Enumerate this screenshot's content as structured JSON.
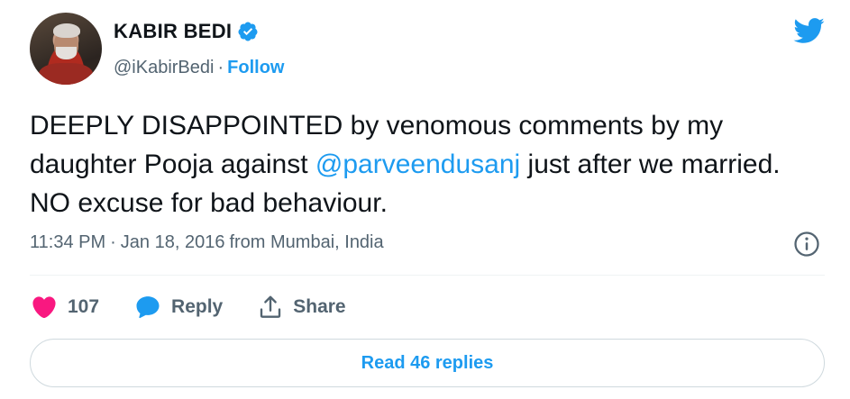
{
  "author": {
    "name": "KABIR BEDI",
    "handle": "@iKabirBedi",
    "separator": "·",
    "follow_label": "Follow",
    "verified": true
  },
  "tweet": {
    "text_before": "DEEPLY DISAPPOINTED by venomous comments by my daughter Pooja against ",
    "mention": "@parveendusanj",
    "text_after": " just after we married. NO excuse for bad behaviour.",
    "time": "11:34 PM",
    "meta_separator": "·",
    "date": "Jan 18, 2016",
    "location": "from Mumbai, India"
  },
  "actions": {
    "like_count": "107",
    "reply_label": "Reply",
    "share_label": "Share"
  },
  "read_replies_label": "Read 46 replies",
  "icons": {
    "brand": "twitter-bird-icon",
    "verified": "verified-badge-icon",
    "info": "info-icon",
    "like": "heart-icon",
    "reply": "speech-bubble-icon",
    "share": "share-upload-icon"
  },
  "colors": {
    "accent": "#1d9bf0",
    "like": "#f91880",
    "secondary_text": "#536471",
    "primary_text": "#0f1419"
  }
}
